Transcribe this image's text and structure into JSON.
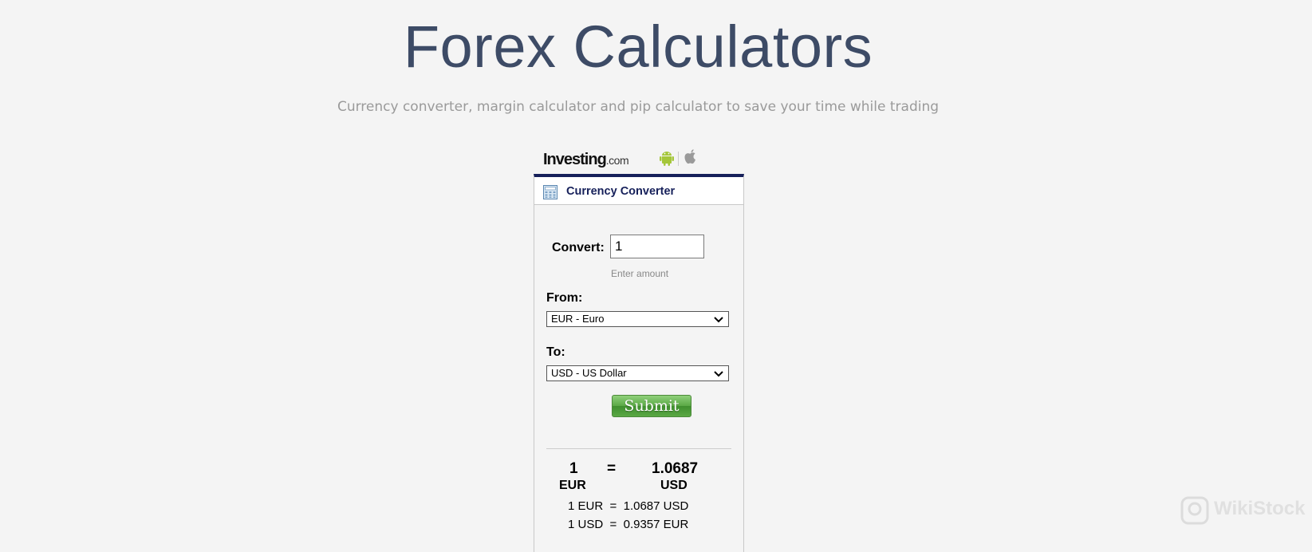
{
  "header": {
    "title": "Forex Calculators",
    "subtitle": "Currency converter, margin calculator and pip calculator to save your time while trading"
  },
  "widget": {
    "logo_main": "Investing",
    "logo_suffix": ".com",
    "tab_title": "Currency Converter",
    "convert_label": "Convert:",
    "amount_value": "1",
    "amount_hint": "Enter amount",
    "from_label": "From:",
    "from_selected": "EUR - Euro",
    "to_label": "To:",
    "to_selected": "USD - US Dollar",
    "submit_label": "Submit",
    "result": {
      "left_amount": "1",
      "equals": "=",
      "right_amount": "1.0687",
      "left_currency": "EUR",
      "right_currency": "USD",
      "rate_line_1": "1 EUR  =  1.0687 USD",
      "rate_line_2": "1 USD  =  0.9357 EUR"
    }
  },
  "watermark": {
    "text": "WikiStock"
  },
  "icons": [
    "android-icon",
    "apple-icon",
    "calculator-icon",
    "chevron-down-icon"
  ],
  "colors": {
    "title": "#3d4b66",
    "tab_border": "#16205a",
    "submit_green": "#5aa845",
    "background": "#f4f4f4"
  }
}
